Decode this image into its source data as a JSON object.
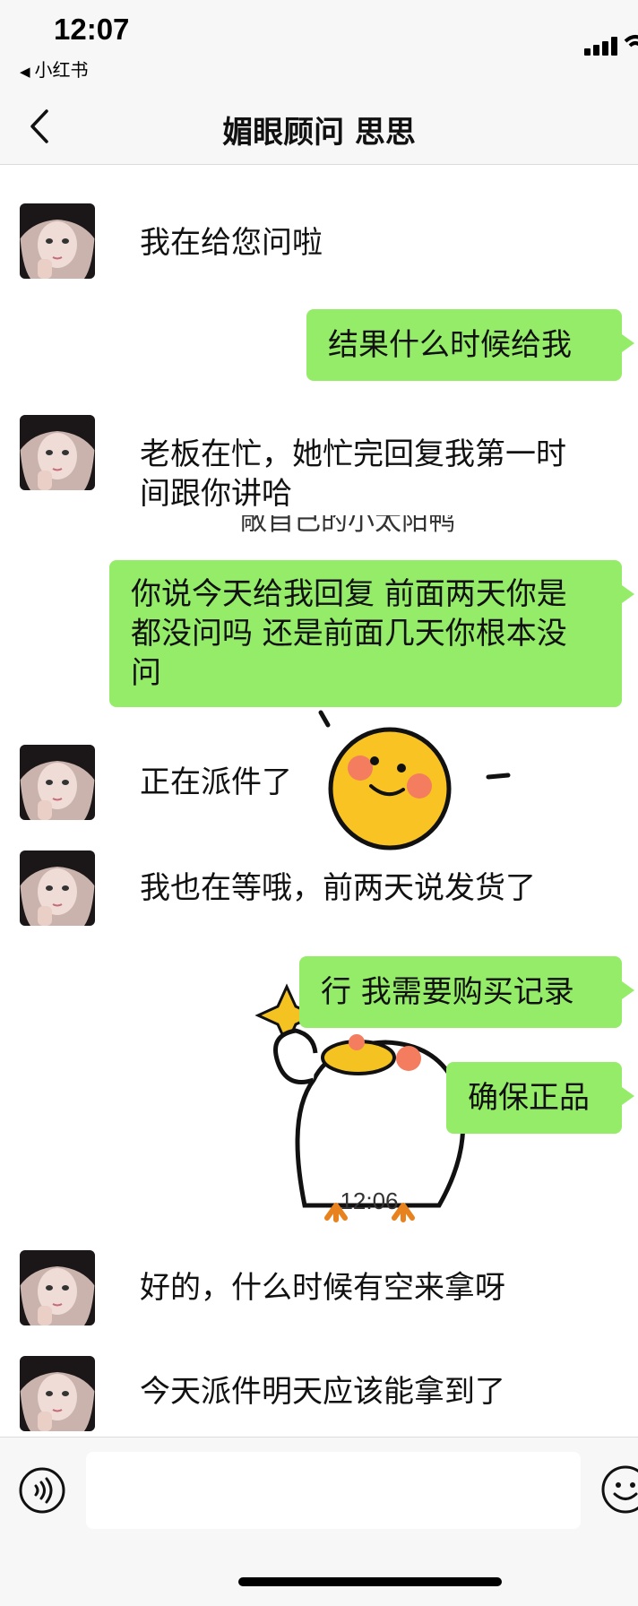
{
  "status_bar": {
    "time": "12:07",
    "back_app": "小红书",
    "back_arrow": "◀"
  },
  "header": {
    "title": "媚眼顾问  思思"
  },
  "messages": [
    {
      "side": "left",
      "text": "我在给您问啦"
    },
    {
      "side": "right",
      "text": "结果什么时候给我"
    },
    {
      "side": "left",
      "lines": [
        "老板在忙，她忙完回复我第一时",
        "间跟你讲哈"
      ]
    },
    {
      "side": "right",
      "lines": [
        "你说今天给我回复 前面两天你是",
        "都没问吗 还是前面几天你根本没",
        "问"
      ]
    },
    {
      "side": "left",
      "text": "正在派件了"
    },
    {
      "side": "left",
      "text": "我也在等哦，前两天说发货了"
    },
    {
      "side": "right",
      "text": "行 我需要购买记录"
    },
    {
      "side": "right",
      "text": "确保正品"
    },
    {
      "side": "left",
      "text": "好的，什么时候有空来拿呀"
    },
    {
      "side": "left",
      "text": "今天派件明天应该能拿到了"
    }
  ],
  "timestamp": "12:06",
  "background_text": "敞自己的小太阳鸭",
  "input": {
    "value": "",
    "placeholder": ""
  },
  "colors": {
    "bubble_right": "#95ec69",
    "bar_bg": "#f7f7f7",
    "chat_bg": "#ffffff"
  },
  "icons": [
    "back-chevron-icon",
    "voice-icon",
    "emoji-icon",
    "signal-icon",
    "wifi-icon"
  ]
}
